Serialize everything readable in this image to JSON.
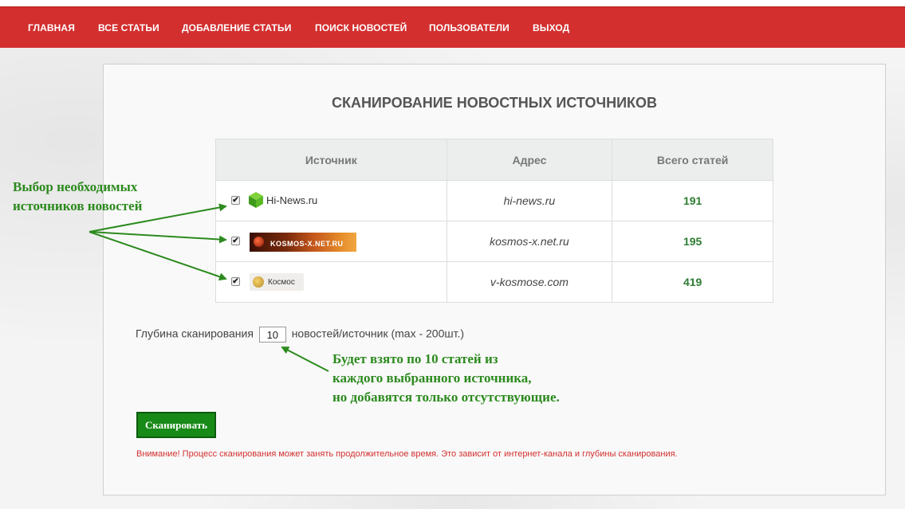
{
  "nav": {
    "items": [
      "ГЛАВНАЯ",
      "ВСЕ СТАТЬИ",
      "ДОБАВЛЕНИЕ СТАТЬИ",
      "ПОИСК НОВОСТЕЙ",
      "ПОЛЬЗОВАТЕЛИ",
      "ВЫХОД"
    ]
  },
  "page": {
    "title": "СКАНИРОВАНИЕ НОВОСТНЫХ ИСТОЧНИКОВ"
  },
  "table": {
    "headers": [
      "Источник",
      "Адрес",
      "Всего статей"
    ],
    "rows": [
      {
        "checked": "✔",
        "logo_text": "Hi-News.ru",
        "address": "hi-news.ru",
        "count": "191"
      },
      {
        "checked": "✔",
        "logo_text": "KOSMOS-X.NET.RU",
        "address": "kosmos-x.net.ru",
        "count": "195"
      },
      {
        "checked": "✔",
        "logo_text": "Космос",
        "address": "v-kosmose.com",
        "count": "419"
      }
    ]
  },
  "depth": {
    "label_before": "Глубина сканирования",
    "value": "10",
    "label_after": "новостей/источник (max - 200шт.)"
  },
  "scan_button": "Сканировать",
  "warning": "Внимание! Процесс сканирования может занять продолжительное время. Это зависит от интернет-канала и глубины сканирования.",
  "annotations": {
    "left_line1": "Выбор необходимых",
    "left_line2": "источников новостей",
    "bottom_line1": "Будет взято по 10 статей из",
    "bottom_line2": "каждого выбранного источника,",
    "bottom_line3": "но добавятся только отсутствующие."
  },
  "colors": {
    "navbar": "#d32f2f",
    "count_text": "#2e7d32",
    "button": "#178a17",
    "warning": "#d32f2f",
    "annotation": "#2c8a1e"
  }
}
